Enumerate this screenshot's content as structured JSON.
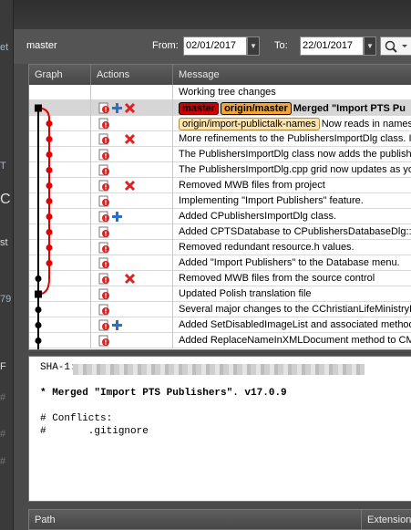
{
  "filter": {
    "branch": "master",
    "from_label": "From:",
    "from_date": "02/01/2017",
    "to_label": "To:",
    "to_date": "22/01/2017"
  },
  "columns": {
    "graph": "Graph",
    "actions": "Actions",
    "message": "Message"
  },
  "log_rows": [
    {
      "message": "Working tree changes"
    },
    {
      "tags": [
        "master",
        "origin/master"
      ],
      "message": "Merged \"Import PTS Pu"
    },
    {
      "tip": "origin/import-publictalk-names",
      "message": "Now reads in names fr"
    },
    {
      "message": "More refinements to the PublishersImportDlg class. It"
    },
    {
      "message": "The PublishersImportDlg class now adds the publisher"
    },
    {
      "message": "The PublishersImportDlg.cpp grid now updates as you"
    },
    {
      "message": "Removed MWB files from project"
    },
    {
      "message": "Implementing \"Import Publishers\" feature."
    },
    {
      "message": "Added CPublishersImportDlg class."
    },
    {
      "message": "Added CPTSDatabase to CPublishersDatabaseDlg::On"
    },
    {
      "message": "Removed redundant resource.h values."
    },
    {
      "message": "Added \"Import Publishers\" to the Database menu."
    },
    {
      "message": "Removed MWB files from the source control"
    },
    {
      "message": "Updated Polish translation file"
    },
    {
      "message": "Several major changes to the CChristianLifeMinistryEd"
    },
    {
      "message": "Added SetDisabledImageList and associated methods"
    },
    {
      "message": "Added ReplaceNameInXMLDocument method to CMSA"
    }
  ],
  "detail": {
    "sha_label": "SHA-1:",
    "commit_line": "* Merged \"Import PTS Publishers\". v17.0.9",
    "conflicts_header": "# Conflicts:",
    "conflict_file": "#       .gitignore"
  },
  "pathbar": {
    "path": "Path",
    "extension": "Extension"
  },
  "colors": {
    "graph_red": "#e00000",
    "graph_black": "#000000",
    "tag_red": "#cc0000",
    "tag_orange": "#f0a43a"
  },
  "bg_strip_chips": [
    "et",
    "T",
    "C",
    "st",
    "79",
    "F",
    "#",
    "#",
    "#"
  ]
}
